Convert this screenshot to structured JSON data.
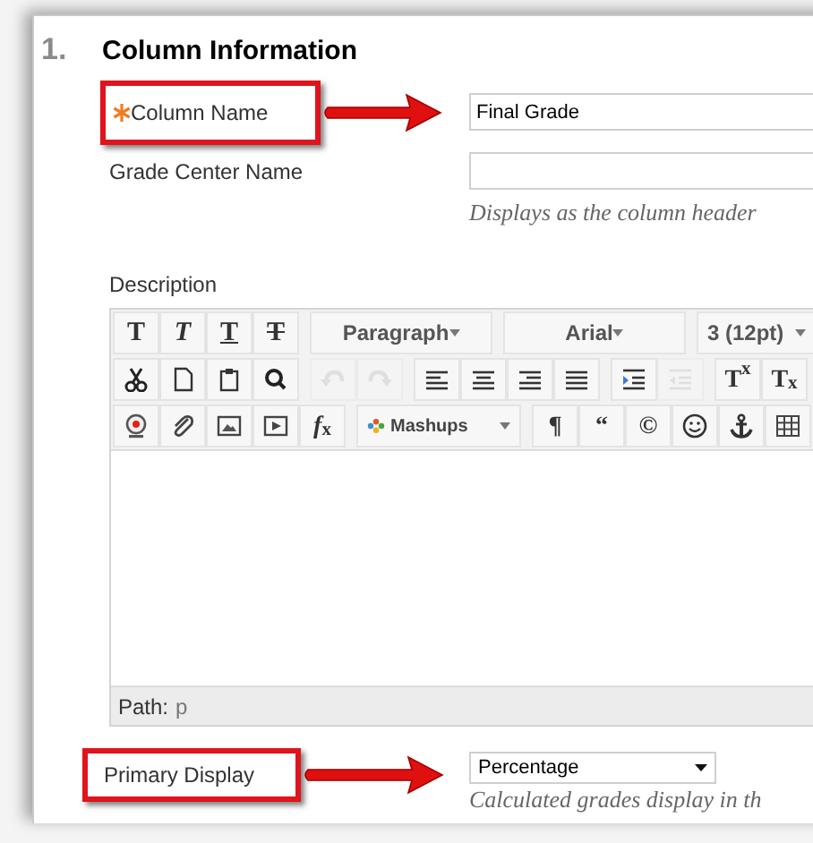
{
  "section": {
    "number": "1.",
    "title": "Column Information"
  },
  "fields": [
    {
      "label": "Column Name",
      "required": true,
      "highlighted": true,
      "value": "Final Grade"
    },
    {
      "label": "Grade Center Name",
      "required": false,
      "highlighted": false,
      "hint": "Displays as the column header"
    }
  ],
  "description": {
    "label": "Description",
    "toolbar": [
      [
        [
          {
            "kind": "format",
            "label": "T"
          },
          {
            "kind": "format",
            "label": "T"
          },
          {
            "kind": "format",
            "label": "T"
          },
          {
            "kind": "format",
            "label": "T"
          }
        ],
        [
          {
            "kind": "dropdown",
            "label": "Paragraph"
          }
        ],
        [
          {
            "kind": "dropdown",
            "label": "Arial"
          }
        ],
        [
          {
            "kind": "dropdown",
            "label": "3 (12pt)"
          }
        ]
      ],
      [
        [
          {
            "kind": "icon",
            "disabled": false
          },
          {
            "kind": "icon",
            "disabled": false
          },
          {
            "kind": "icon",
            "disabled": false
          },
          {
            "kind": "icon",
            "disabled": false
          }
        ],
        [
          {
            "kind": "icon",
            "disabled": true
          },
          {
            "kind": "icon",
            "disabled": true
          }
        ],
        [
          {
            "kind": "icon",
            "disabled": false
          },
          {
            "kind": "icon",
            "disabled": false
          },
          {
            "kind": "icon",
            "disabled": false
          },
          {
            "kind": "icon",
            "disabled": false
          }
        ],
        [
          {
            "kind": "icon",
            "disabled": false
          },
          {
            "kind": "icon",
            "disabled": true
          }
        ],
        [
          {
            "kind": "glyph",
            "label": "T$^{x}$"
          },
          {
            "kind": "glyph",
            "label": "T$_{x}$"
          }
        ]
      ],
      [
        [
          {
            "kind": "icon",
            "disabled": false
          },
          {
            "kind": "icon",
            "disabled": false
          },
          {
            "kind": "icon",
            "disabled": false
          },
          {
            "kind": "icon",
            "disabled": false
          },
          {
            "kind": "glyph",
            "label": "*f*$_{x}$"
          }
        ],
        [
          {
            "kind": "menu",
            "label": "Mashups"
          }
        ],
        [
          {
            "kind": "glyph",
            "label": "¶"
          },
          {
            "kind": "glyph",
            "label": "“"
          },
          {
            "kind": "glyph",
            "label": "©"
          },
          {
            "kind": "icon",
            "disabled": false
          },
          {
            "kind": "icon",
            "disabled": false
          },
          {
            "kind": "icon",
            "disabled": false
          }
        ]
      ]
    ],
    "path_label": "Path:",
    "path_value": "p"
  },
  "primary_display": {
    "label": "Primary Display",
    "highlighted": true,
    "value": "Percentage",
    "hint": "Calculated grades display in th"
  }
}
